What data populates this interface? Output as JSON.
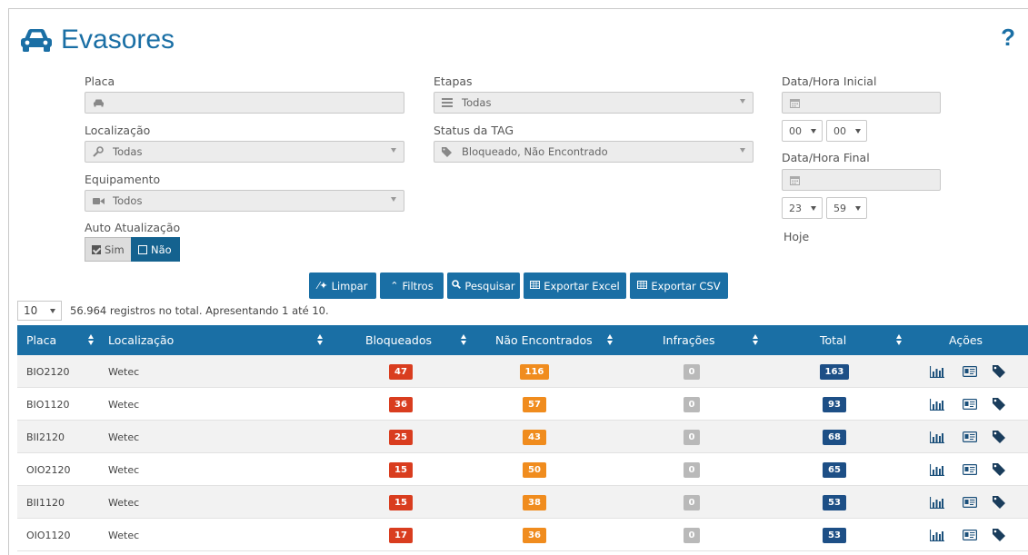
{
  "page": {
    "title": "Evasores",
    "help": "?"
  },
  "filters": {
    "placa": {
      "label": "Placa",
      "value": ""
    },
    "localizacao": {
      "label": "Localização",
      "value": "Todas"
    },
    "equipamento": {
      "label": "Equipamento",
      "value": "Todos"
    },
    "auto": {
      "label": "Auto Atualização",
      "sim": "Sim",
      "nao": "Não"
    },
    "etapas": {
      "label": "Etapas",
      "value": "Todas"
    },
    "status": {
      "label": "Status da TAG",
      "value": "Bloqueado, Não Encontrado"
    },
    "inicial": {
      "label": "Data/Hora Inicial",
      "hour": "00",
      "minute": "00"
    },
    "final": {
      "label": "Data/Hora Final",
      "hour": "23",
      "minute": "59"
    },
    "hoje": "Hoje"
  },
  "buttons": {
    "limpar": "Limpar",
    "filtros": "Filtros",
    "pesquisar": "Pesquisar",
    "excel": "Exportar Excel",
    "csv": "Exportar CSV"
  },
  "paging": {
    "per_page": "10",
    "info": "56.964 registros no total. Apresentando 1 até 10."
  },
  "table": {
    "headers": {
      "placa": "Placa",
      "localizacao": "Localização",
      "bloqueados": "Bloqueados",
      "nao_encontrados": "Não Encontrados",
      "infracoes": "Infrações",
      "total": "Total",
      "acoes": "Ações"
    },
    "rows": [
      {
        "placa": "BIO2120",
        "local": "Wetec",
        "bloq": "47",
        "nao": "116",
        "inf": "0",
        "total": "163"
      },
      {
        "placa": "BIO1120",
        "local": "Wetec",
        "bloq": "36",
        "nao": "57",
        "inf": "0",
        "total": "93"
      },
      {
        "placa": "BII2120",
        "local": "Wetec",
        "bloq": "25",
        "nao": "43",
        "inf": "0",
        "total": "68"
      },
      {
        "placa": "OIO2120",
        "local": "Wetec",
        "bloq": "15",
        "nao": "50",
        "inf": "0",
        "total": "65"
      },
      {
        "placa": "BII1120",
        "local": "Wetec",
        "bloq": "15",
        "nao": "38",
        "inf": "0",
        "total": "53"
      },
      {
        "placa": "OIO1120",
        "local": "Wetec",
        "bloq": "17",
        "nao": "36",
        "inf": "0",
        "total": "53"
      }
    ]
  },
  "colors": {
    "primary": "#1a6fa5",
    "bloq": "#d93d1f",
    "nao": "#f08c1e",
    "inf": "#b9b9b9",
    "total": "#1d4f86"
  }
}
